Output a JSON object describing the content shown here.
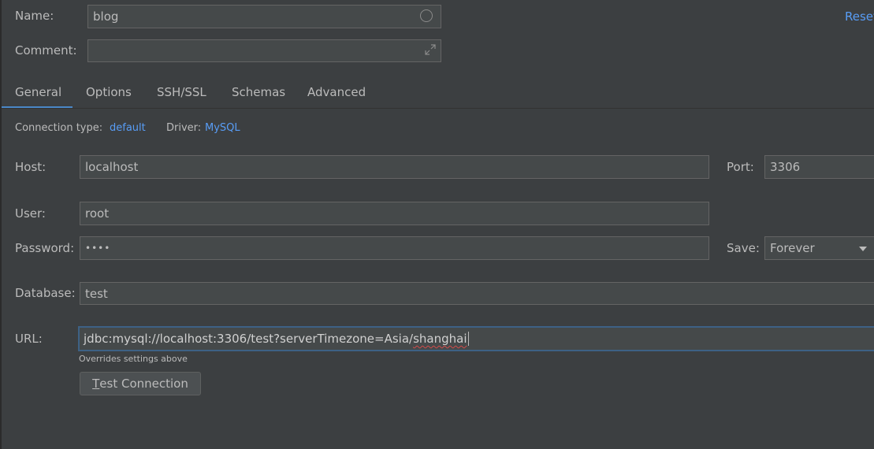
{
  "header": {
    "name_label": "Name:",
    "name_value": "blog",
    "comment_label": "Comment:",
    "comment_value": "",
    "reset_link": "Reset"
  },
  "tabs": [
    {
      "label": "General",
      "active": true
    },
    {
      "label": "Options",
      "active": false
    },
    {
      "label": "SSH/SSL",
      "active": false
    },
    {
      "label": "Schemas",
      "active": false
    },
    {
      "label": "Advanced",
      "active": false
    }
  ],
  "connection": {
    "type_label": "Connection type:",
    "type_value": "default",
    "driver_label": "Driver:",
    "driver_value": "MySQL"
  },
  "form": {
    "host_label": "Host:",
    "host_value": "localhost",
    "port_label": "Port:",
    "port_value": "3306",
    "user_label": "User:",
    "user_value": "root",
    "password_label": "Password:",
    "password_mask": "••••",
    "save_label": "Save:",
    "save_value": "Forever",
    "database_label": "Database:",
    "database_value": "test",
    "url_label": "URL:",
    "url_prefix": "jdbc:mysql://localhost:3306/test?serverTimezone=Asia/",
    "url_misspelled": "shanghai",
    "url_hint": "Overrides settings above",
    "test_button_mnemonic": "T",
    "test_button_rest": "est Connection"
  },
  "colors": {
    "background": "#3c3f41",
    "field_bg": "#45494a",
    "link": "#589df6",
    "tab_underline": "#4a88c7",
    "focus_border": "#3d6185"
  }
}
